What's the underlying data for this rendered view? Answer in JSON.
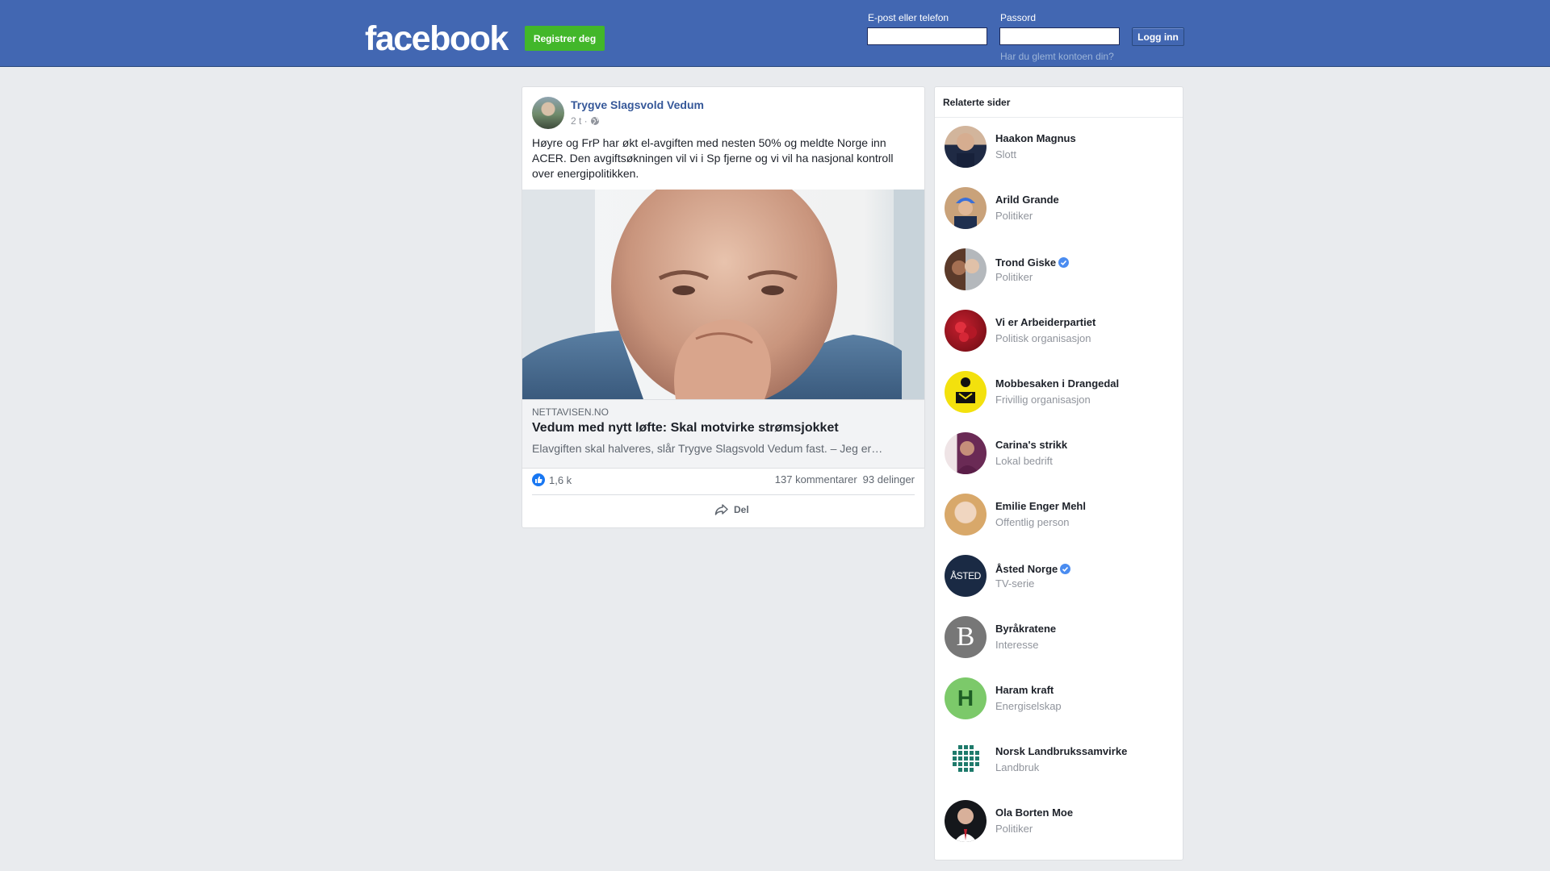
{
  "header": {
    "logo": "facebook",
    "register_label": "Registrer deg",
    "email_label": "E-post eller telefon",
    "password_label": "Passord",
    "login_label": "Logg inn",
    "forgot_label": "Har du glemt kontoen din?",
    "email_value": "",
    "password_value": ""
  },
  "post": {
    "author": "Trygve Slagsvold Vedum",
    "time": "2 t ·",
    "text": "Høyre og FrP har økt el-avgiften med nesten 50% og meldte Norge inn ACER. Den avgiftsøkningen vil vi i Sp fjerne og vi vil ha nasjonal kontroll over energipolitikken.",
    "link": {
      "domain": "NETTAVISEN.NO",
      "title": "Vedum med nytt løfte: Skal motvirke strømsjokket",
      "description": "Elavgiften skal halveres, slår Trygve Slagsvold Vedum fast. – Jeg er…"
    },
    "likes": "1,6 k",
    "comments": "137 kommentarer",
    "shares": "93 delinger",
    "share_label": "Del"
  },
  "related": {
    "title": "Relaterte sider",
    "items": [
      {
        "name": "Haakon Magnus",
        "category": "Slott",
        "verified": false
      },
      {
        "name": "Arild Grande",
        "category": "Politiker",
        "verified": false
      },
      {
        "name": "Trond Giske",
        "category": "Politiker",
        "verified": true
      },
      {
        "name": "Vi er Arbeiderpartiet",
        "category": "Politisk organisasjon",
        "verified": false
      },
      {
        "name": "Mobbesaken i Drangedal",
        "category": "Frivillig organisasjon",
        "verified": false
      },
      {
        "name": "Carina's strikk",
        "category": "Lokal bedrift",
        "verified": false
      },
      {
        "name": "Emilie Enger Mehl",
        "category": "Offentlig person",
        "verified": false
      },
      {
        "name": "Åsted Norge",
        "category": "TV-serie",
        "verified": true,
        "avatar_text": "ÅSTED"
      },
      {
        "name": "Byråkratene",
        "category": "Interesse",
        "verified": false,
        "avatar_text": "B"
      },
      {
        "name": "Haram kraft",
        "category": "Energiselskap",
        "verified": false,
        "avatar_text": "H"
      },
      {
        "name": "Norsk Landbrukssamvirke",
        "category": "Landbruk",
        "verified": false
      },
      {
        "name": "Ola Borten Moe",
        "category": "Politiker",
        "verified": false
      }
    ]
  },
  "colors": {
    "brand": "#4267b2",
    "register_green": "#42b72a",
    "link_blue": "#365899"
  }
}
